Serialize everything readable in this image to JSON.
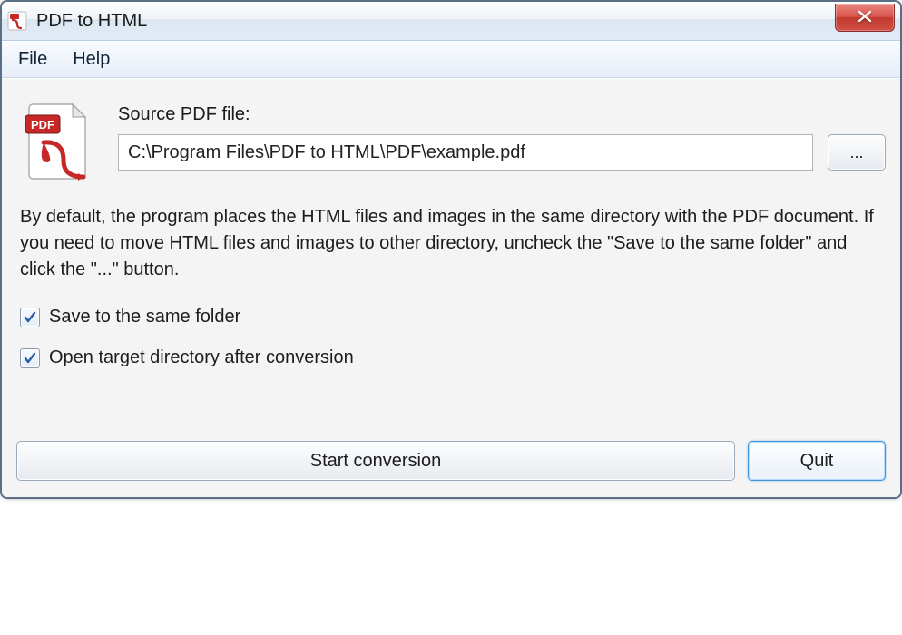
{
  "window": {
    "title": "PDF to HTML"
  },
  "menu": {
    "file": "File",
    "help": "Help"
  },
  "source": {
    "label": "Source PDF file:",
    "path": "C:\\Program Files\\PDF to HTML\\PDF\\example.pdf",
    "browse_label": "..."
  },
  "description": "By default, the program places the HTML files and images in the same directory with the PDF document. If you need to move HTML files and images to other directory, uncheck the \"Save to the same folder\" and click the \"...\" button.",
  "options": {
    "save_same_folder": {
      "label": "Save to the same folder",
      "checked": true
    },
    "open_target_dir": {
      "label": "Open target directory after conversion",
      "checked": true
    }
  },
  "buttons": {
    "start": "Start conversion",
    "quit": "Quit"
  }
}
